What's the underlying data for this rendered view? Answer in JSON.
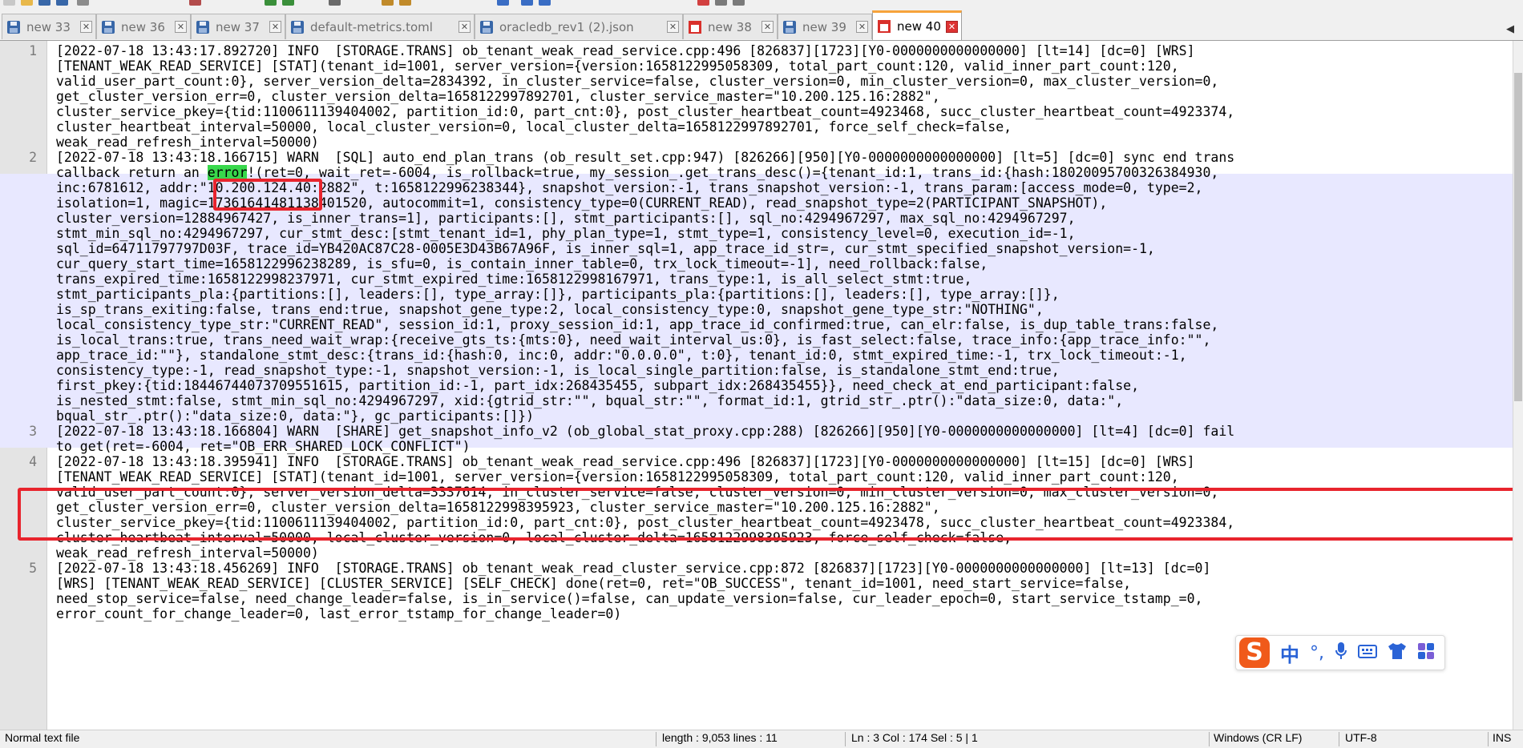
{
  "tabs": [
    {
      "label": "new 33",
      "icon": "save-icon",
      "active": false
    },
    {
      "label": "new 36",
      "icon": "save-icon",
      "active": false
    },
    {
      "label": "new 37",
      "icon": "save-icon",
      "active": false
    },
    {
      "label": "default-metrics.toml",
      "icon": "save-icon",
      "active": false
    },
    {
      "label": "oracledb_rev1 (2).json",
      "icon": "save-icon",
      "active": false
    },
    {
      "label": "new 38",
      "icon": "unsaved-file-icon",
      "active": false
    },
    {
      "label": "new 39",
      "icon": "save-icon",
      "active": false
    },
    {
      "label": "new 40",
      "icon": "unsaved-file-icon",
      "active": true
    }
  ],
  "editor": {
    "lines": [
      {
        "num": "1",
        "text": "[2022-07-18 13:43:17.892720] INFO  [STORAGE.TRANS] ob_tenant_weak_read_service.cpp:496 [826837][1723][Y0-0000000000000000] [lt=14] [dc=0] [WRS]"
      },
      {
        "num": "",
        "text": "[TENANT_WEAK_READ_SERVICE] [STAT](tenant_id=1001, server_version={version:1658122995058309, total_part_count:120, valid_inner_part_count:120,"
      },
      {
        "num": "",
        "text": "valid_user_part_count:0}, server_version_delta=2834392, in_cluster_service=false, cluster_version=0, min_cluster_version=0, max_cluster_version=0,"
      },
      {
        "num": "",
        "text": "get_cluster_version_err=0, cluster_version_delta=1658122997892701, cluster_service_master=\"10.200.125.16:2882\","
      },
      {
        "num": "",
        "text": "cluster_service_pkey={tid:1100611139404002, partition_id:0, part_cnt:0}, post_cluster_heartbeat_count=4923468, succ_cluster_heartbeat_count=4923374,"
      },
      {
        "num": "",
        "text": "cluster_heartbeat_interval=50000, local_cluster_version=0, local_cluster_delta=1658122997892701, force_self_check=false,"
      },
      {
        "num": "",
        "text": "weak_read_refresh_interval=50000)"
      },
      {
        "num": "2",
        "text": "[2022-07-18 13:43:18.166715] WARN  [SQL] auto_end_plan_trans (ob_result_set.cpp:947) [826266][950][Y0-0000000000000000] [lt=5] [dc=0] sync end trans"
      },
      {
        "num": "",
        "text": "callback return an ",
        "mark": "error",
        "rest": "!(ret=0, wait_ret=-6004, is_rollback=true, my_session_.get_trans_desc()={tenant_id:1, trans_id:{hash:18020095700326384930,"
      },
      {
        "num": "",
        "text": "inc:6781612, addr:\"10.200.124.40:2882\", t:1658122996238344}, snapshot_version:-1, trans_snapshot_version:-1, trans_param:[access_mode=0, type=2,"
      },
      {
        "num": "",
        "text": "isolation=1, magic=17361641481138401520, autocommit=1, consistency_type=0(CURRENT_READ), read_snapshot_type=2(PARTICIPANT_SNAPSHOT),"
      },
      {
        "num": "",
        "text": "cluster_version=12884967427, is_inner_trans=1], participants:[], stmt_participants:[], sql_no:4294967297, max_sql_no:4294967297,"
      },
      {
        "num": "",
        "text": "stmt_min_sql_no:4294967297, cur_stmt_desc:[stmt_tenant_id=1, phy_plan_type=1, stmt_type=1, consistency_level=0, execution_id=-1,"
      },
      {
        "num": "",
        "text": "sql_id=64711797797D03F, trace_id=YB420AC87C28-0005E3D43B67A96F, is_inner_sql=1, app_trace_id_str=, cur_stmt_specified_snapshot_version=-1,"
      },
      {
        "num": "",
        "text": "cur_query_start_time=1658122996238289, is_sfu=0, is_contain_inner_table=0, trx_lock_timeout=-1], need_rollback:false,"
      },
      {
        "num": "",
        "text": "trans_expired_time:1658122998237971, cur_stmt_expired_time:1658122998167971, trans_type:1, is_all_select_stmt:true,"
      },
      {
        "num": "",
        "text": "stmt_participants_pla:{partitions:[], leaders:[], type_array:[]}, participants_pla:{partitions:[], leaders:[], type_array:[]},"
      },
      {
        "num": "",
        "text": "is_sp_trans_exiting:false, trans_end:true, snapshot_gene_type:2, local_consistency_type:0, snapshot_gene_type_str:\"NOTHING\","
      },
      {
        "num": "",
        "text": "local_consistency_type_str:\"CURRENT_READ\", session_id:1, proxy_session_id:1, app_trace_id_confirmed:true, can_elr:false, is_dup_table_trans:false,"
      },
      {
        "num": "",
        "text": "is_local_trans:true, trans_need_wait_wrap:{receive_gts_ts:{mts:0}, need_wait_interval_us:0}, is_fast_select:false, trace_info:{app_trace_info:\"\","
      },
      {
        "num": "",
        "text": "app_trace_id:\"\"}, standalone_stmt_desc:{trans_id:{hash:0, inc:0, addr:\"0.0.0.0\", t:0}, tenant_id:0, stmt_expired_time:-1, trx_lock_timeout:-1,"
      },
      {
        "num": "",
        "text": "consistency_type:-1, read_snapshot_type:-1, snapshot_version:-1, is_local_single_partition:false, is_standalone_stmt_end:true,"
      },
      {
        "num": "",
        "text": "first_pkey:{tid:18446744073709551615, partition_id:-1, part_idx:268435455, subpart_idx:268435455}}, need_check_at_end_participant:false,"
      },
      {
        "num": "",
        "text": "is_nested_stmt:false, stmt_min_sql_no:4294967297, xid:{gtrid_str:\"\", bqual_str:\"\", format_id:1, gtrid_str_.ptr():\"data_size:0, data:\","
      },
      {
        "num": "",
        "text": "bqual_str_.ptr():\"data_size:0, data:\"}, gc_participants:[]})"
      },
      {
        "num": "3",
        "text": "[2022-07-18 13:43:18.166804] WARN  [SHARE] get_snapshot_info_v2 (ob_global_stat_proxy.cpp:288) [826266][950][Y0-0000000000000000] [lt=4] [dc=0] fail"
      },
      {
        "num": "",
        "text": "to get(ret=-6004, ret=\"OB_ERR_SHARED_LOCK_CONFLICT\")"
      },
      {
        "num": "4",
        "text": "[2022-07-18 13:43:18.395941] INFO  [STORAGE.TRANS] ob_tenant_weak_read_service.cpp:496 [826837][1723][Y0-0000000000000000] [lt=15] [dc=0] [WRS]"
      },
      {
        "num": "",
        "text": "[TENANT_WEAK_READ_SERVICE] [STAT](tenant_id=1001, server_version={version:1658122995058309, total_part_count:120, valid_inner_part_count:120,"
      },
      {
        "num": "",
        "text": "valid_user_part_count:0}, server_version_delta=3337614, in_cluster_service=false, cluster_version=0, min_cluster_version=0, max_cluster_version=0,"
      },
      {
        "num": "",
        "text": "get_cluster_version_err=0, cluster_version_delta=1658122998395923, cluster_service_master=\"10.200.125.16:2882\","
      },
      {
        "num": "",
        "text": "cluster_service_pkey={tid:1100611139404002, partition_id:0, part_cnt:0}, post_cluster_heartbeat_count=4923478, succ_cluster_heartbeat_count=4923384,"
      },
      {
        "num": "",
        "text": "cluster_heartbeat_interval=50000, local_cluster_version=0, local_cluster_delta=1658122998395923, force_self_check=false,"
      },
      {
        "num": "",
        "text": "weak_read_refresh_interval=50000)"
      },
      {
        "num": "5",
        "text": "[2022-07-18 13:43:18.456269] INFO  [STORAGE.TRANS] ob_tenant_weak_read_cluster_service.cpp:872 [826837][1723][Y0-0000000000000000] [lt=13] [dc=0]"
      },
      {
        "num": "",
        "text": "[WRS] [TENANT_WEAK_READ_SERVICE] [CLUSTER_SERVICE] [SELF_CHECK] done(ret=0, ret=\"OB_SUCCESS\", tenant_id=1001, need_start_service=false,"
      },
      {
        "num": "",
        "text": "need_stop_service=false, need_change_leader=false, is_in_service()=false, can_update_version=false, cur_leader_epoch=0, start_service_tstamp_=0,"
      },
      {
        "num": "",
        "text": "error_count_for_change_leader=0, last_error_tstamp_for_change_leader=0)"
      }
    ]
  },
  "ime": {
    "logo": "S",
    "language": "中",
    "punctuation": "°,",
    "mic_icon": "microphone-icon",
    "keyboard_icon": "keyboard-icon",
    "skin_icon": "shirt-icon",
    "tools_icon": "grid-icon"
  },
  "statusbar": {
    "file_type": "Normal text file",
    "length": "length : 9,053    lines : 11",
    "position": "Ln : 3    Col : 174    Sel : 5 | 1",
    "eol": "Windows (CR LF)",
    "encoding": "UTF-8",
    "mode": "INS"
  },
  "colors": {
    "active_tab_accent": "#f7a33b",
    "search_match": "#38d84c",
    "current_line": "#e8e8ff",
    "annotation_box": "#e8242d"
  }
}
